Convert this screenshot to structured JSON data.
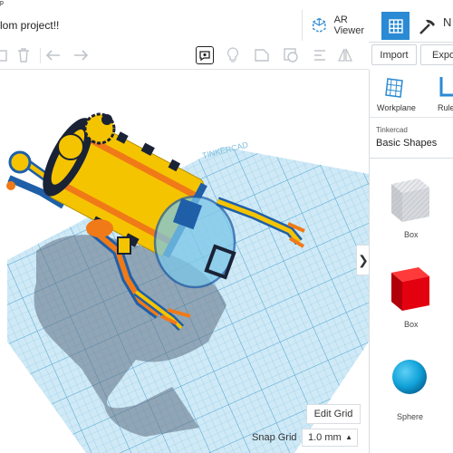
{
  "header": {
    "crumb": "p",
    "title": "lom project!!",
    "ar_viewer_label": "AR Viewer",
    "right_partial": "N"
  },
  "toolbar": {
    "import_label": "Import",
    "export_label": "Expo"
  },
  "panel": {
    "workplane_label": "Workplane",
    "ruler_label": "Rule",
    "category_source": "Tinkercad",
    "category_name": "Basic Shapes",
    "shapes": [
      {
        "label": "Box",
        "color": "#c8cbd0"
      },
      {
        "label": "Box",
        "color": "#e3000f"
      },
      {
        "label": "Sphere",
        "color": "#11a3d9"
      }
    ]
  },
  "workspace": {
    "edit_grid_label": "Edit Grid",
    "snap_grid_label": "Snap Grid",
    "snap_grid_value": "1.0 mm",
    "collapse_glyph": "❯",
    "grid_watermark": "TINKERCAD",
    "model_colors": {
      "body": "#f5c400",
      "stripe": "#f07a18",
      "dome": "#7cc7e8",
      "grid": "#9fd3ec"
    }
  },
  "colors": {
    "accent": "#2b8ad4"
  }
}
